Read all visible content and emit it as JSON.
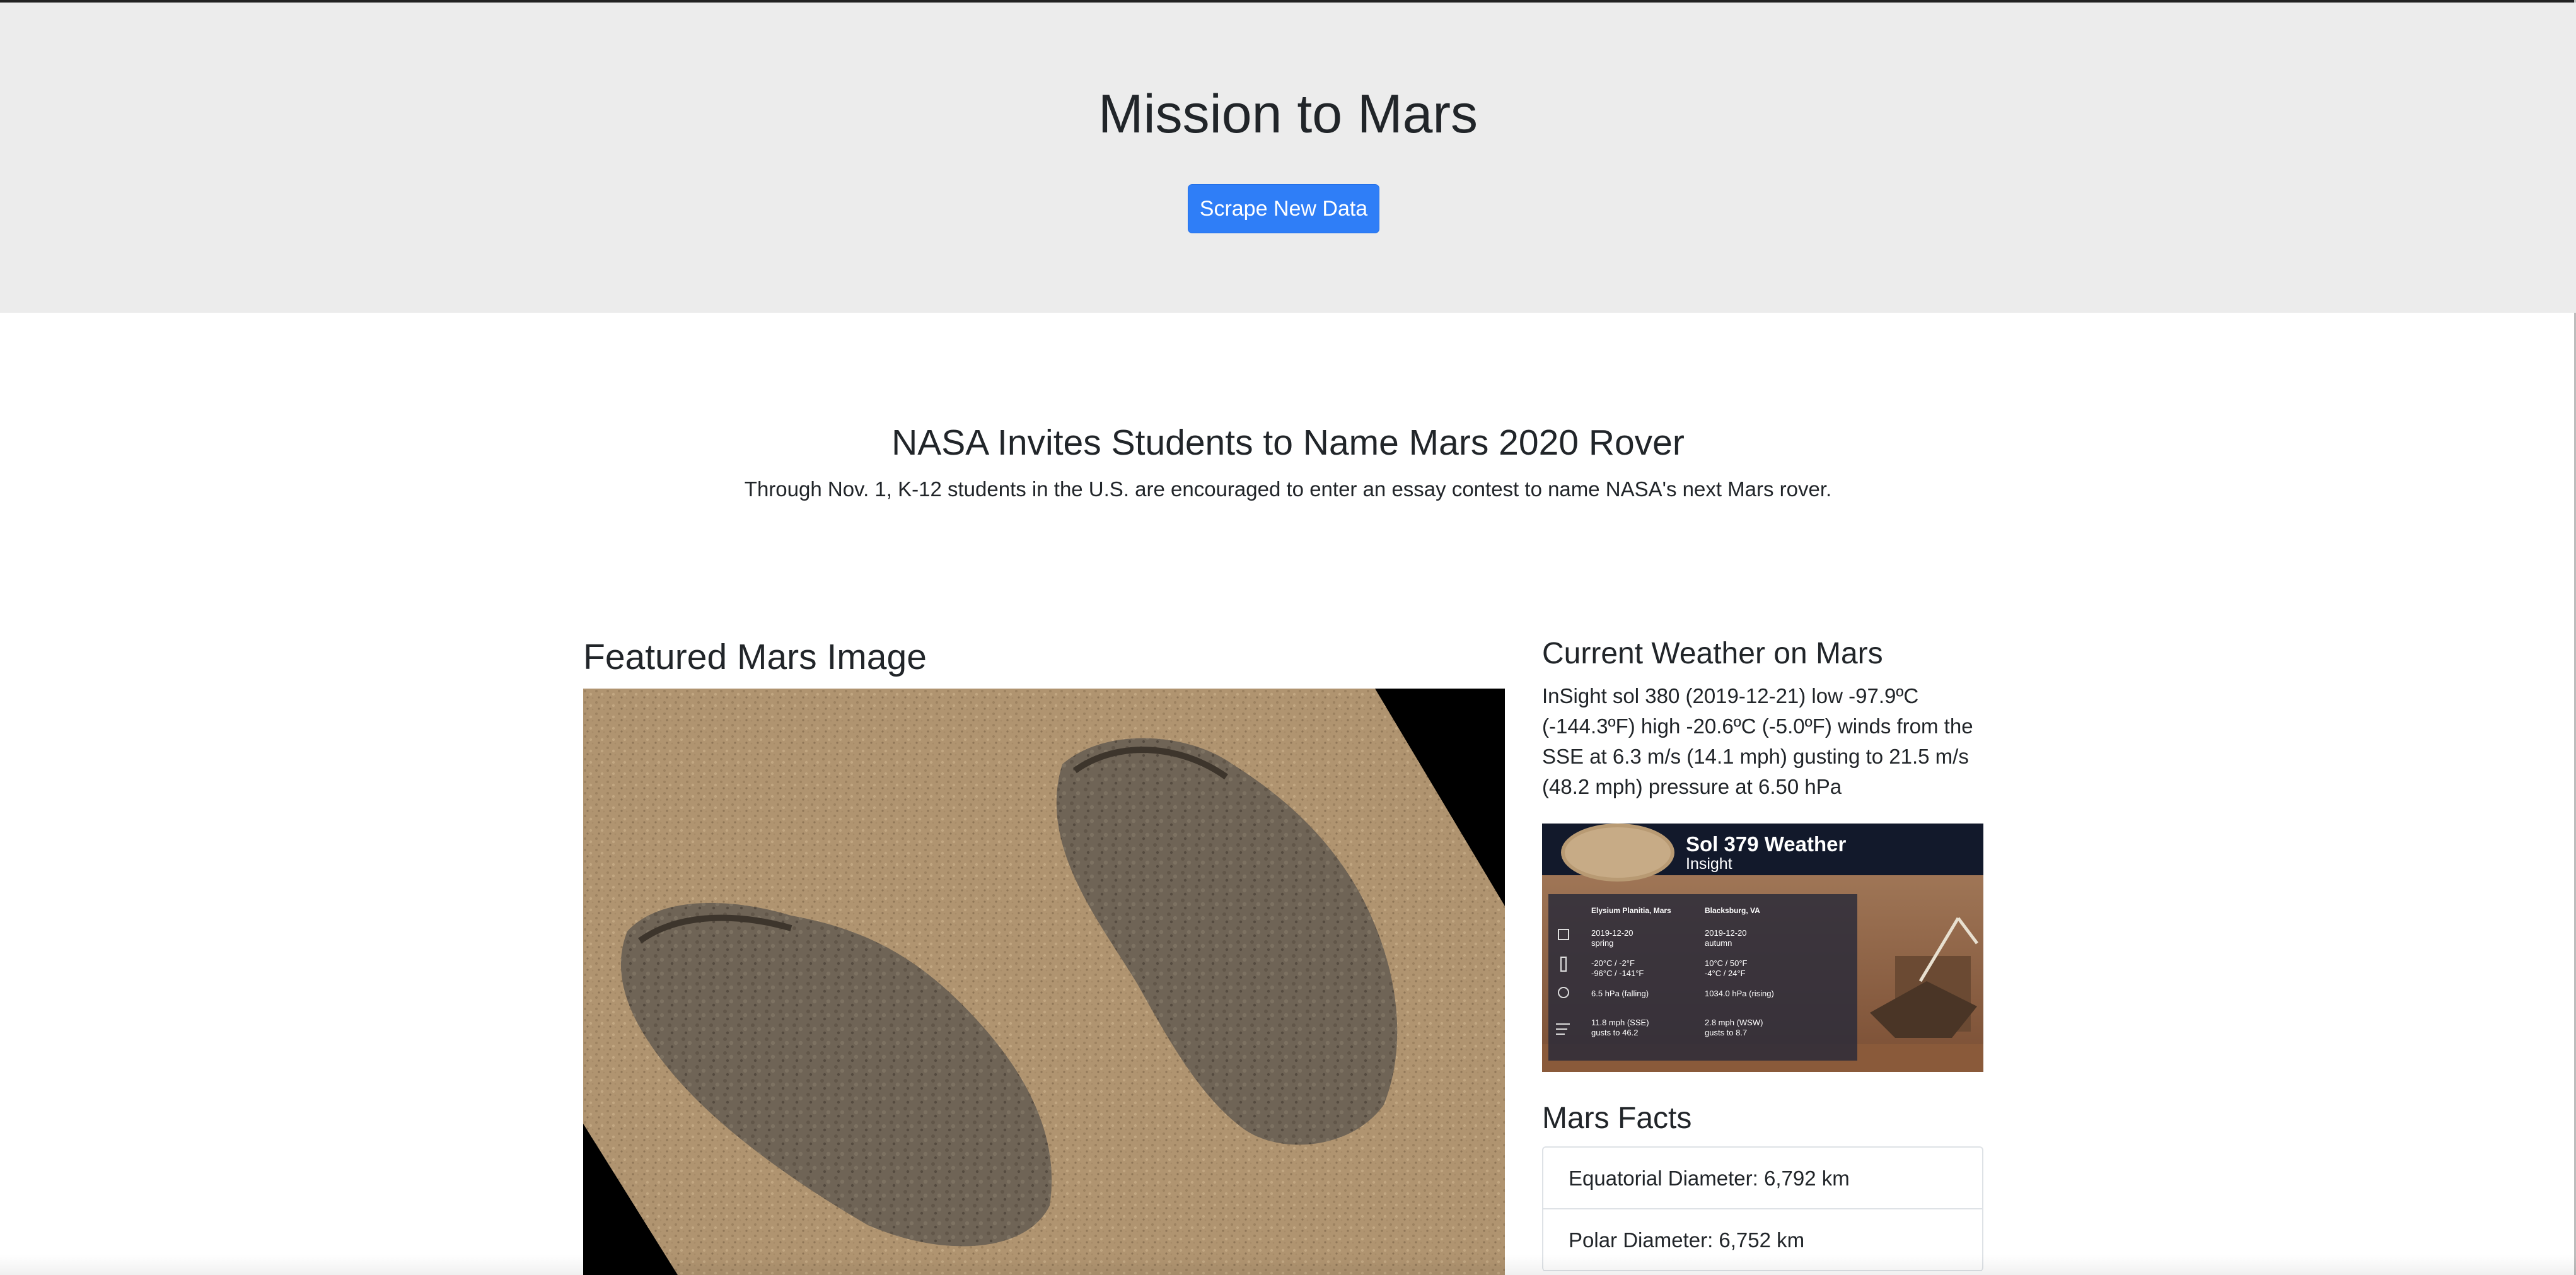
{
  "header": {
    "title": "Mission to Mars",
    "scrape_button_label": "Scrape New Data"
  },
  "news": {
    "title": "NASA Invites Students to Name Mars 2020 Rover",
    "teaser": "Through Nov. 1, K-12 students in the U.S. are encouraged to enter an essay contest to name NASA's next Mars rover."
  },
  "featured": {
    "heading": "Featured Mars Image"
  },
  "weather": {
    "heading": "Current Weather on Mars",
    "text": "InSight sol 380 (2019-12-21) low -97.9ºC (-144.3ºF) high -20.6ºC (-5.0ºF) winds from the SSE at 6.3 m/s (14.1 mph) gusting to 21.5 m/s (48.2 mph) pressure at 6.50 hPa",
    "image": {
      "title": "Sol 379 Weather",
      "subtitle": "Insight",
      "col_a_header": "Elysium Planitia, Mars",
      "col_b_header": "Blacksburg, VA",
      "rows": [
        {
          "a1": "2019-12-20",
          "a2": "spring",
          "b1": "2019-12-20",
          "b2": "autumn"
        },
        {
          "a1": "-20°C / -2°F",
          "a2": "-96°C / -141°F",
          "b1": "10°C / 50°F",
          "b2": "-4°C / 24°F"
        },
        {
          "a1": "6.5 hPa (falling)",
          "a2": "",
          "b1": "1034.0 hPa (rising)",
          "b2": ""
        },
        {
          "a1": "11.8 mph (SSE)",
          "a2": "gusts to 46.2",
          "b1": "2.8 mph (WSW)",
          "b2": "gusts to 8.7"
        }
      ]
    }
  },
  "facts": {
    "heading": "Mars Facts",
    "items": [
      "Equatorial Diameter: 6,792 km",
      "Polar Diameter: 6,752 km"
    ]
  }
}
